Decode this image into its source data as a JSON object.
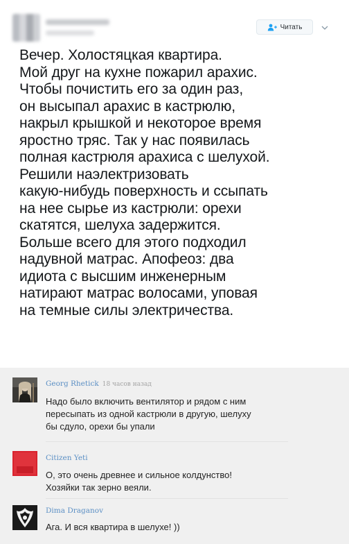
{
  "tweet": {
    "follow_label": "Читать",
    "text": "Вечер. Холостяцкая квартира.\nМой друг на кухне пожарил арахис.\nЧтобы почистить его за один раз,\nон высыпал арахис в кастрюлю,\nнакрыл крышкой и некоторое время\nяростно тряс. Так у нас появилась\nполная кастрюля арахиса с шелухой.\nРешили наэлектризовать\nкакую-нибудь поверхность и ссыпать\nна нее сырье из кастрюли: орехи\nскатятся, шелуха задержится.\nБольше всего для этого подходил\nнадувной матрас. Апофеоз: два\nидиота с высшим инженерным\nнатирают матрас волосами, уповая\nна темные силы электричества."
  },
  "comments": [
    {
      "author": "Georg Rhetick",
      "time": "18 часов назад",
      "text": "Надо было включить вентилятор и рядом с ним\nпересыпать из одной кастрюли в другую, шелуху\nбы сдуло, орехи бы упали"
    },
    {
      "author": "Citizen Yeti",
      "time": "",
      "text": "О, это очень древнее и сильное колдунство!\nХозяйки так зерно веяли."
    },
    {
      "author": "Dima Draganov",
      "time": "",
      "text": "Ага. И вся квартира в шелухе! ))"
    }
  ],
  "colors": {
    "link": "#5b8fc4",
    "comments_bg": "#f0f0f0",
    "yeti_avatar": "#d9232e"
  }
}
